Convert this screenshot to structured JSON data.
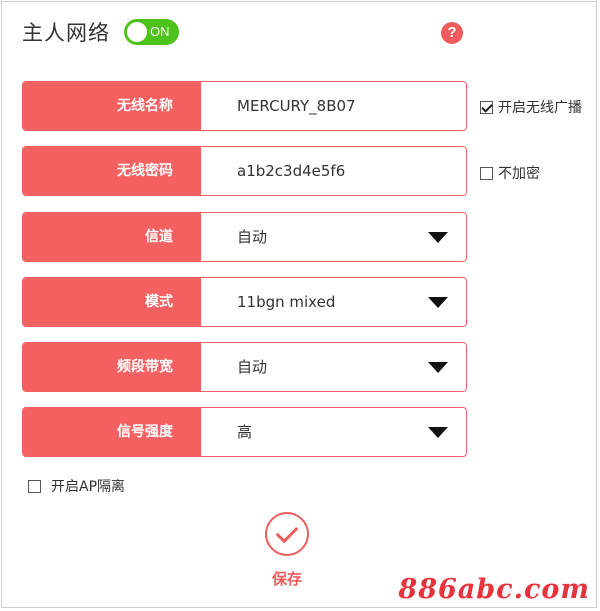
{
  "header": {
    "title": "主人网络",
    "toggle_label": "ON",
    "help_icon": "question-icon"
  },
  "fields": [
    {
      "label": "无线名称",
      "value": "MERCURY_8B07",
      "type": "text"
    },
    {
      "label": "无线密码",
      "value": "a1b2c3d4e5f6",
      "type": "text"
    },
    {
      "label": "信道",
      "value": "自动",
      "type": "select"
    },
    {
      "label": "模式",
      "value": "11bgn mixed",
      "type": "select"
    },
    {
      "label": "频段带宽",
      "value": "自动",
      "type": "select"
    },
    {
      "label": "信号强度",
      "value": "高",
      "type": "select"
    }
  ],
  "options": {
    "broadcast_label": "开启无线广播",
    "broadcast_checked": true,
    "no_encrypt_label": "不加密",
    "no_encrypt_checked": false,
    "ap_isolation_label": "开启AP隔离",
    "ap_isolation_checked": false
  },
  "save": {
    "label": "保存"
  },
  "watermark": "886abc.com",
  "colors": {
    "accent": "#f56161",
    "toggle_on": "#4cc21a",
    "watermark": "#e8323c"
  }
}
